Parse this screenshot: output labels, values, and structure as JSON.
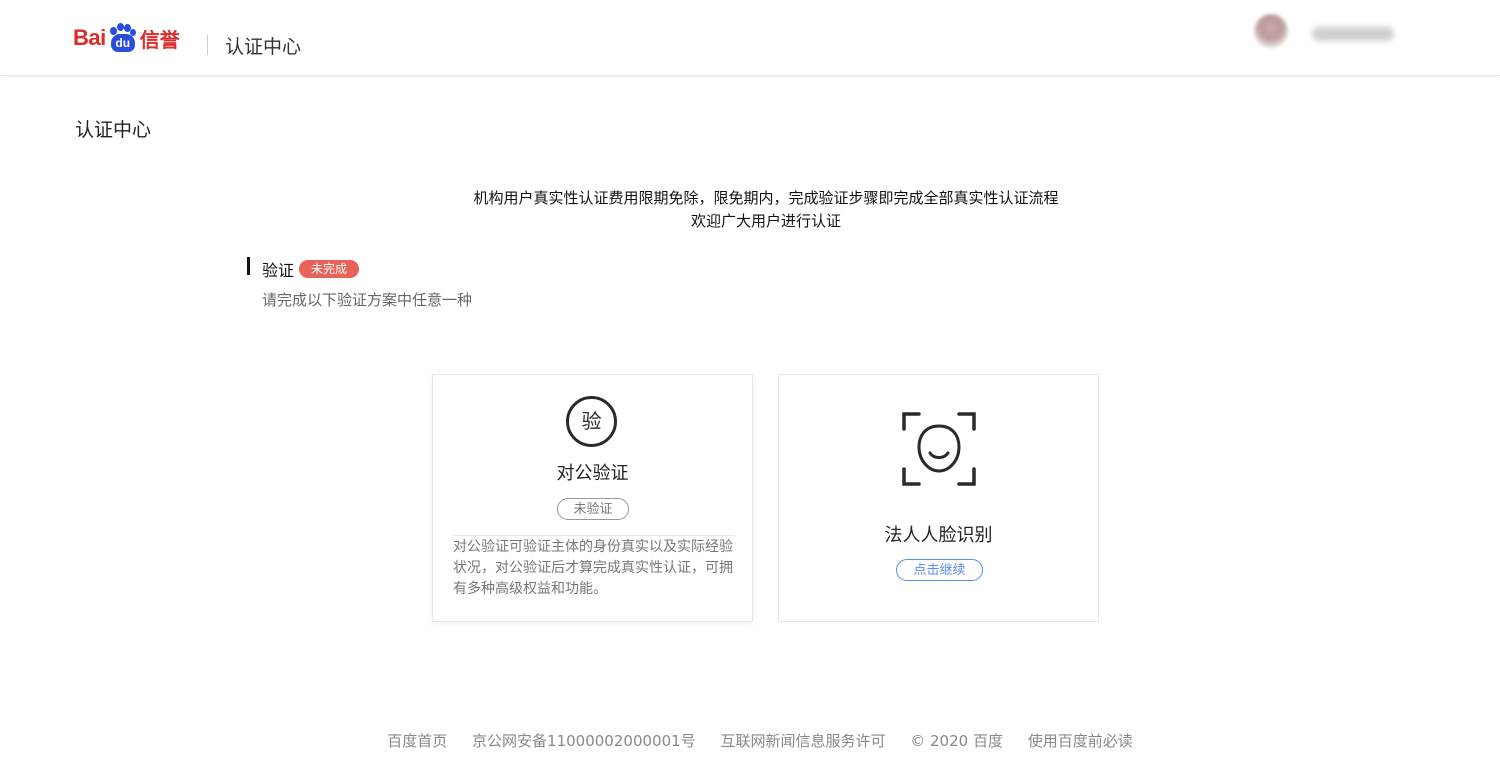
{
  "header": {
    "logo": {
      "part1": "Bai",
      "paw_text": "du",
      "part2": "信誉"
    },
    "title": "认证中心"
  },
  "page": {
    "title": "认证中心",
    "notice_line1": "机构用户真实性认证费用限期免除，限免期内，完成验证步骤即完成全部真实性认证流程",
    "notice_line2": "欢迎广大用户进行认证"
  },
  "section": {
    "title": "验证",
    "status_badge": "未完成",
    "subtitle": "请完成以下验证方案中任意一种"
  },
  "cards": [
    {
      "icon_char": "验",
      "title": "对公验证",
      "status": "未验证",
      "description": "对公验证可验证主体的身份真实以及实际经验状况，对公验证后才算完成真实性认证，可拥有多种高级权益和功能。"
    },
    {
      "title": "法人人脸识别",
      "action": "点击继续"
    }
  ],
  "footer": {
    "links": [
      "百度首页",
      "京公网安备11000002000001号",
      "互联网新闻信息服务许可",
      "© 2020 百度",
      "使用百度前必读"
    ]
  },
  "colors": {
    "brand_red": "#de2b2b",
    "brand_blue": "#2a4de0",
    "badge_red": "#e86259",
    "link_blue": "#5b8cf0"
  }
}
